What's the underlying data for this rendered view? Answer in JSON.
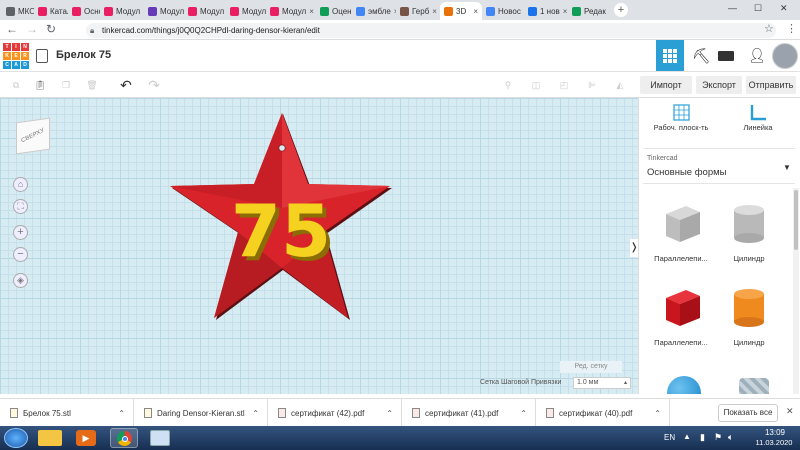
{
  "browser": {
    "tabs": [
      {
        "label": "МКОУ",
        "color": "#5f6368"
      },
      {
        "label": "Катало",
        "color": "#e91e63"
      },
      {
        "label": "Основ",
        "color": "#e91e63"
      },
      {
        "label": "Модул",
        "color": "#e91e63"
      },
      {
        "label": "Модул",
        "color": "#673ab7"
      },
      {
        "label": "Модул",
        "color": "#e91e63"
      },
      {
        "label": "Модул",
        "color": "#e91e63"
      },
      {
        "label": "Модул",
        "color": "#e91e63"
      },
      {
        "label": "Оценк",
        "color": "#0f9d58"
      },
      {
        "label": "эмбле",
        "color": "#4285f4"
      },
      {
        "label": "Герб",
        "color": "#795548"
      },
      {
        "label": "3D",
        "color": "#e8710a"
      },
      {
        "label": "Новос",
        "color": "#4285f4"
      },
      {
        "label": "1 нов",
        "color": "#1a73e8"
      },
      {
        "label": "Редак",
        "color": "#0f9d58"
      }
    ],
    "active_tab_index": 11,
    "url": "tinkercad.com/things/j0Q0Q2CHPdl-daring-densor-kieran/edit"
  },
  "app": {
    "logo_letters": [
      "T",
      "I",
      "N",
      "K",
      "E",
      "R",
      "C",
      "A",
      "D"
    ],
    "title": "Брелок 75",
    "header_colors": {
      "accent": "#2a9fd6",
      "work_bg": "#d6ebf2"
    }
  },
  "toolbar": {
    "import_label": "Импорт",
    "export_label": "Экспорт",
    "send_label": "Отправить"
  },
  "viewcube": {
    "label": "СВЕРХУ"
  },
  "model": {
    "text": "75",
    "star_color": "#d8232a",
    "text_color": "#f5d21f"
  },
  "workplane": {
    "edit_grid_label": "Ред. сетку",
    "snap_label": "Сетка Шаговой Привязки",
    "snap_value": "1.0 мм"
  },
  "panel": {
    "workplane_label": "Рабоч. плоск-ть",
    "ruler_label": "Линейка",
    "library_label": "Tinkercad",
    "category_label": "Основные формы",
    "shapes": [
      {
        "label": "Параллелепи...",
        "kind": "box-gray"
      },
      {
        "label": "Цилиндр",
        "kind": "cyl-gray"
      },
      {
        "label": "Параллелепи...",
        "kind": "box-red"
      },
      {
        "label": "Цилиндр",
        "kind": "cyl-orange"
      }
    ]
  },
  "downloads": {
    "items": [
      {
        "label": "Брелок 75.stl",
        "kind": "file"
      },
      {
        "label": "Daring Densor-Kieran.stl",
        "kind": "file"
      },
      {
        "label": "сертификат (42).pdf",
        "kind": "pdf"
      },
      {
        "label": "сертификат (41).pdf",
        "kind": "pdf"
      },
      {
        "label": "сертификат (40).pdf",
        "kind": "pdf"
      }
    ],
    "show_all_label": "Показать все"
  },
  "taskbar": {
    "lang": "EN",
    "time": "13:09",
    "date": "11.03.2020"
  }
}
